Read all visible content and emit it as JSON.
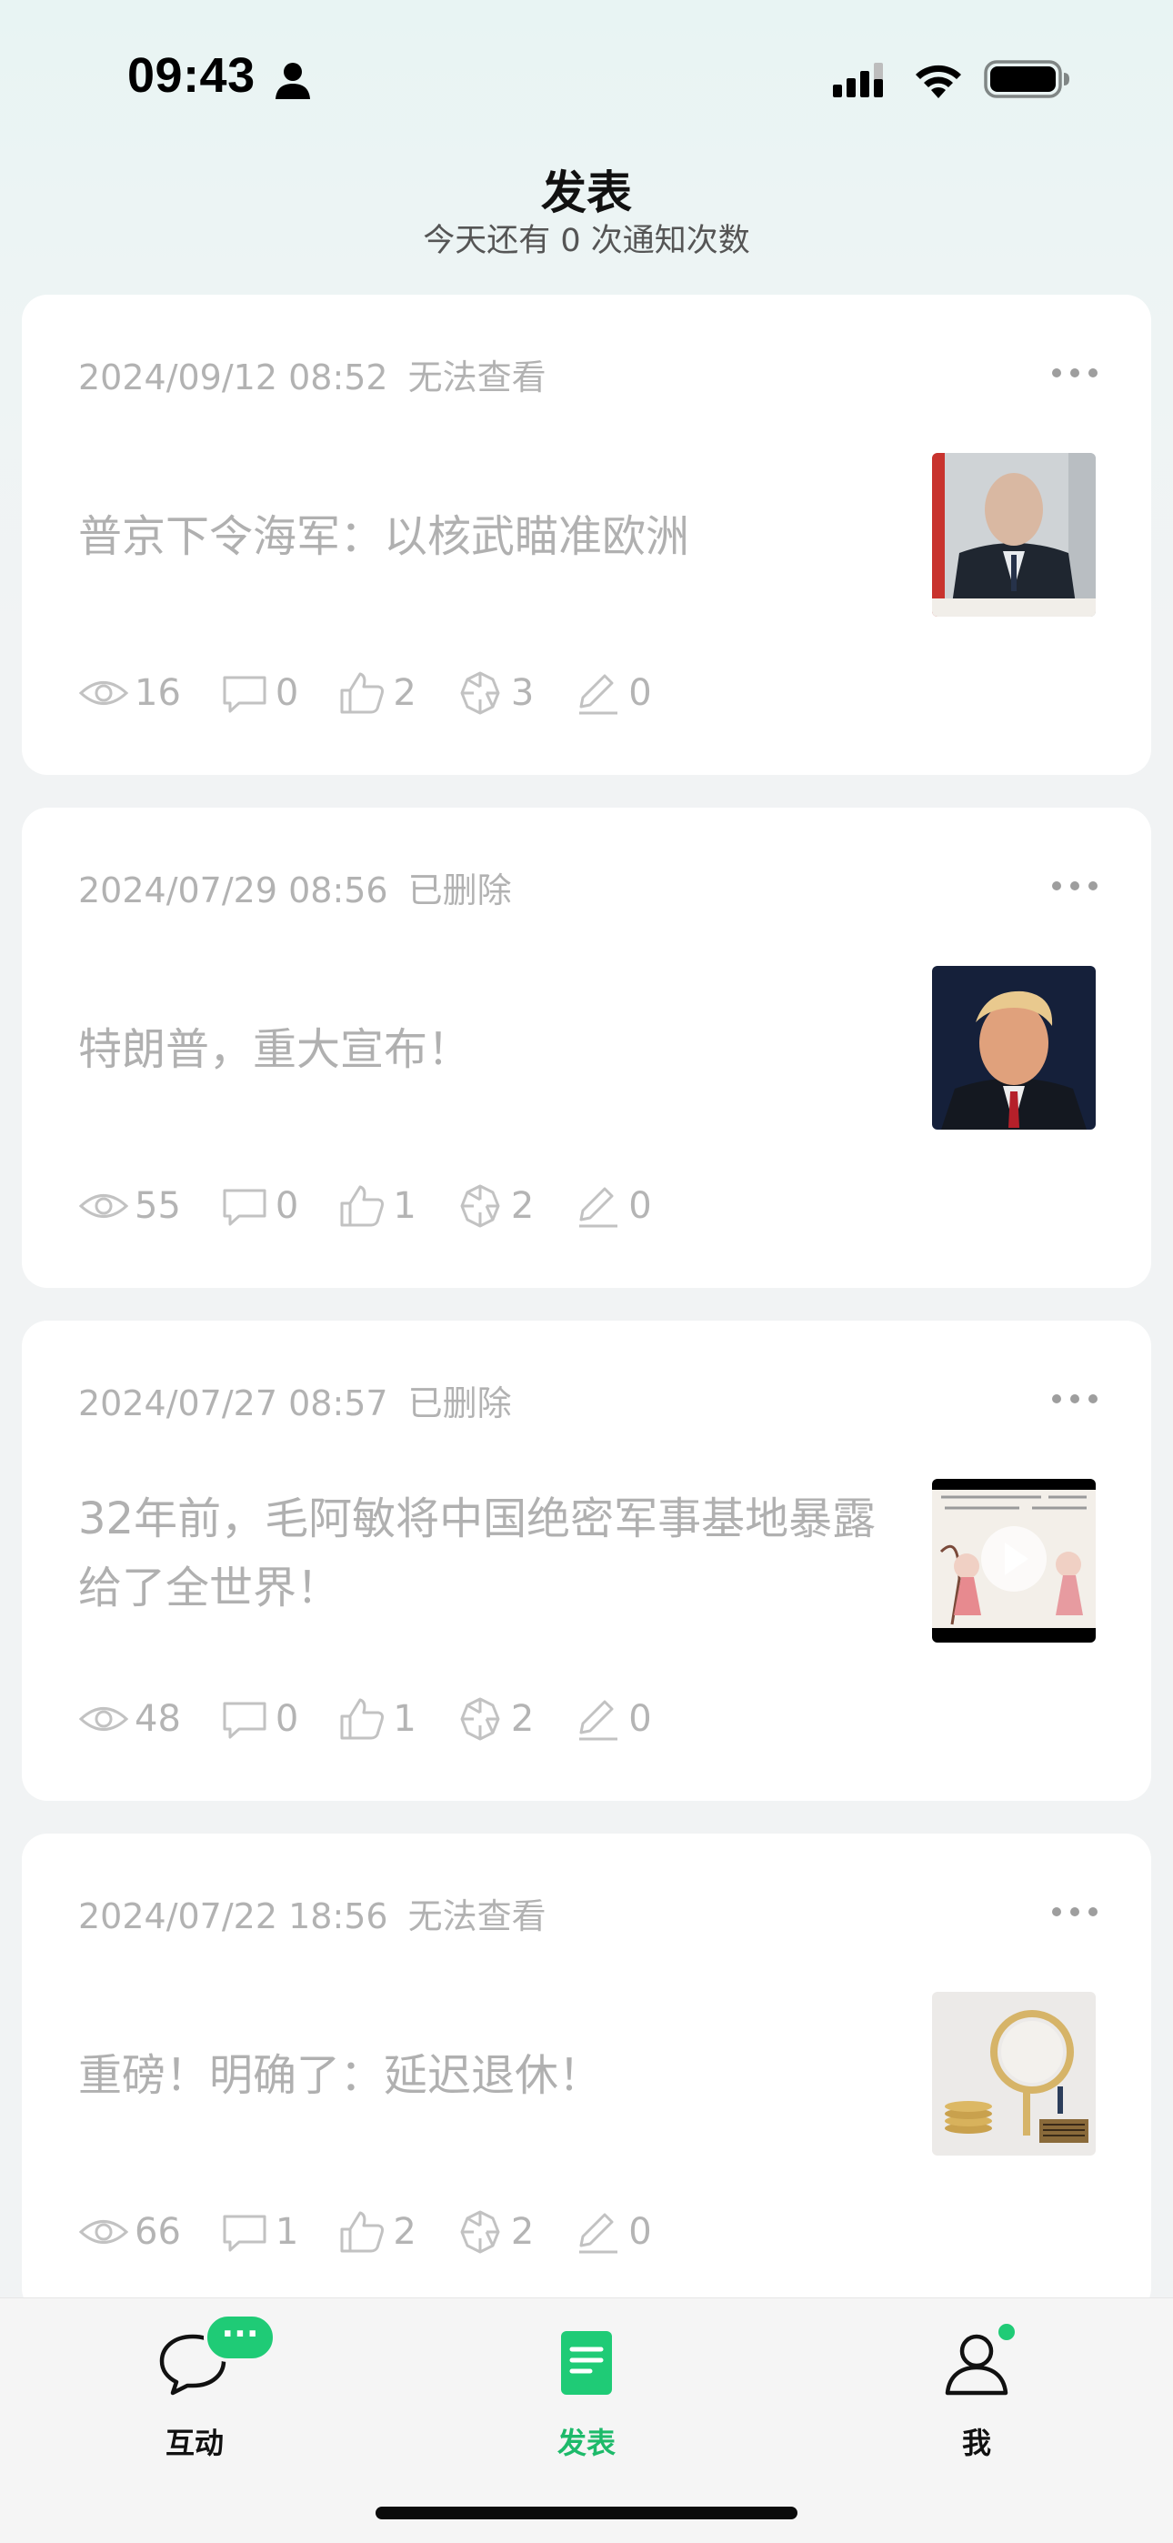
{
  "status_bar": {
    "time": "09:43"
  },
  "header": {
    "title": "发表",
    "subtitle": "今天还有 0 次通知次数"
  },
  "posts": [
    {
      "date": "2024/09/12 08:52",
      "status": "无法查看",
      "title": "普京下令海军：以核武瞄准欧洲",
      "thumbnail_icon": "photo-thumbnail",
      "stats": {
        "views": "16",
        "comments": "0",
        "likes": "2",
        "shares": "3",
        "edits": "0"
      }
    },
    {
      "date": "2024/07/29 08:56",
      "status": "已删除",
      "title": "特朗普，重大宣布！",
      "thumbnail_icon": "photo-thumbnail",
      "stats": {
        "views": "55",
        "comments": "0",
        "likes": "1",
        "shares": "2",
        "edits": "0"
      }
    },
    {
      "date": "2024/07/27 08:57",
      "status": "已删除",
      "title": "32年前，毛阿敏将中国绝密军事基地暴露给了全世界！",
      "thumbnail_icon": "video-thumbnail",
      "stats": {
        "views": "48",
        "comments": "0",
        "likes": "1",
        "shares": "2",
        "edits": "0"
      }
    },
    {
      "date": "2024/07/22 18:56",
      "status": "无法查看",
      "title": "重磅！明确了：延迟退休！",
      "thumbnail_icon": "photo-thumbnail",
      "stats": {
        "views": "66",
        "comments": "1",
        "likes": "2",
        "shares": "2",
        "edits": "0"
      }
    }
  ],
  "tab_bar": {
    "interact": {
      "label": "互动",
      "badge": "···"
    },
    "publish": {
      "label": "发表"
    },
    "me": {
      "label": "我"
    }
  },
  "colors": {
    "accent": "#1fcb76",
    "active_tab": "#1dba6a",
    "muted_text": "#b0b0b0",
    "card_bg": "#ffffff"
  }
}
